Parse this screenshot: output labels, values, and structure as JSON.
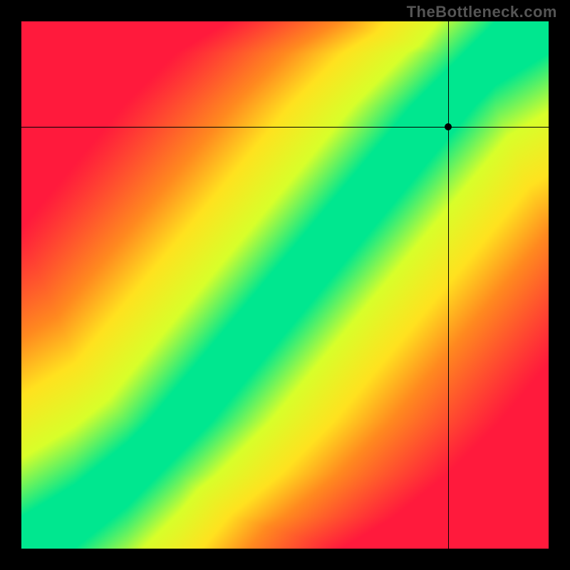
{
  "watermark": "TheBottleneck.com",
  "chart_data": {
    "type": "heatmap",
    "title": "",
    "xlabel": "",
    "ylabel": "",
    "xlim": [
      0,
      100
    ],
    "ylim": [
      0,
      100
    ],
    "crosshair": {
      "x": 81,
      "y": 80
    },
    "marker": {
      "x": 81,
      "y": 80
    },
    "optimal_curve": [
      {
        "x": 0,
        "y": 0
      },
      {
        "x": 10,
        "y": 6
      },
      {
        "x": 20,
        "y": 14
      },
      {
        "x": 30,
        "y": 24
      },
      {
        "x": 40,
        "y": 36
      },
      {
        "x": 50,
        "y": 48
      },
      {
        "x": 60,
        "y": 60
      },
      {
        "x": 70,
        "y": 72
      },
      {
        "x": 80,
        "y": 84
      },
      {
        "x": 90,
        "y": 94
      },
      {
        "x": 100,
        "y": 100
      }
    ],
    "band_half_width": 6,
    "colorscale": [
      {
        "stop": 0.0,
        "color": "#ff1a3c"
      },
      {
        "stop": 0.35,
        "color": "#ff8a1f"
      },
      {
        "stop": 0.55,
        "color": "#ffe21f"
      },
      {
        "stop": 0.78,
        "color": "#d8ff2a"
      },
      {
        "stop": 1.0,
        "color": "#00e78f"
      }
    ],
    "legend": []
  }
}
